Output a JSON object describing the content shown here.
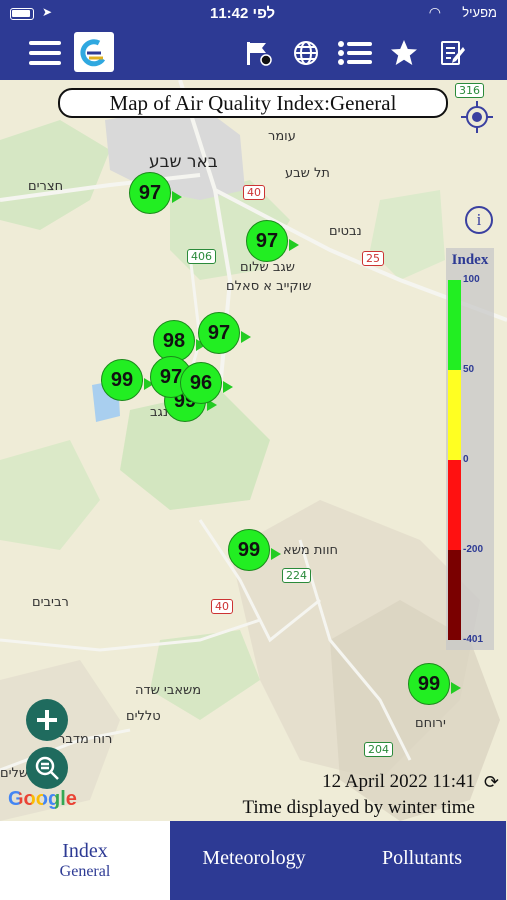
{
  "status_bar": {
    "time": "11:42 לפי",
    "carrier": "מפעיל"
  },
  "header": {
    "icons": [
      "menu-icon",
      "app-logo",
      "flag-icon",
      "globe-icon",
      "list-icon",
      "star-icon",
      "edit-icon"
    ]
  },
  "map": {
    "title": "Map of Air Quality Index:General",
    "places": [
      "עומר",
      "באר שבע",
      "תל שבע",
      "חצרים",
      "נבטים",
      "שגב שלום",
      "שוקייב א סאלם",
      "נגב",
      "חוות משא",
      "רביבים",
      "משאבי שדה",
      "טללים",
      "רוח מדבר",
      "ירוחם",
      "אשלים"
    ],
    "roads": [
      "316",
      "40",
      "406",
      "25",
      "224",
      "40",
      "204"
    ],
    "markers": [
      {
        "value": "97"
      },
      {
        "value": "97"
      },
      {
        "value": "98"
      },
      {
        "value": "97"
      },
      {
        "value": "99"
      },
      {
        "value": "97"
      },
      {
        "value": "96"
      },
      {
        "value": "99"
      },
      {
        "value": "99"
      },
      {
        "value": "99"
      }
    ],
    "legend": {
      "title": "Index",
      "ticks": [
        "100",
        "50",
        "0",
        "-200",
        "-401"
      ],
      "colors": [
        "#22ee22",
        "#ffff22",
        "#ff1111",
        "#7a0000"
      ]
    },
    "info_label": "i",
    "attribution": "Google",
    "date_time": "12 April 2022 11:41",
    "time_note": "Time displayed by winter time"
  },
  "tabs": [
    {
      "label": "Index",
      "sublabel": "General",
      "active": true
    },
    {
      "label": "Meteorology"
    },
    {
      "label": "Pollutants"
    }
  ]
}
